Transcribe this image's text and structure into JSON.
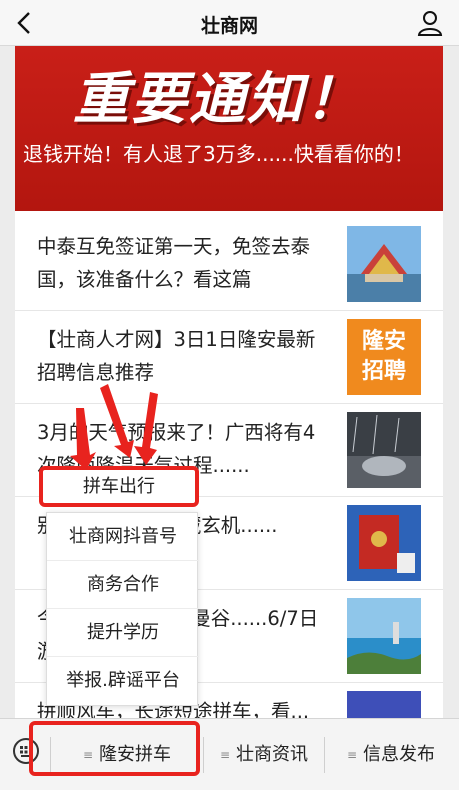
{
  "topbar": {
    "title": "壮商网",
    "back_icon": "back-chevron-icon",
    "user_icon": "user-icon"
  },
  "banner": {
    "headline": "重要通知！",
    "subtext": "退钱开始！有人退了3万多......快看看你的！"
  },
  "news": [
    {
      "text": "中泰互免签证第一天，免签去泰国，该准备什么？看这篇"
    },
    {
      "text": "【壮商人才网】3日1日隆安最新招聘信息推荐",
      "thumb_text": "隆安招聘"
    },
    {
      "text": "3月的天气预报来了！广西将有4次降雨降温天气过程......"
    },
    {
      "text": "别......的扫码“暗藏玄机......"
    },
    {
      "text": "今......推荐：泰国曼谷......6/7日游！"
    },
    {
      "text": "拼顺风车，长途短途拼车，看..."
    }
  ],
  "menu_popup": {
    "items": [
      "拼车出行",
      "壮商网抖音号",
      "商务合作",
      "提升学历",
      "举报.辟谣平台"
    ]
  },
  "bottom_nav": {
    "keyboard_icon": "keyboard-icon",
    "tabs": [
      {
        "label": "隆安拼车"
      },
      {
        "label": "壮商资讯"
      },
      {
        "label": "信息发布"
      }
    ]
  },
  "colors": {
    "banner_red": "#c91f18",
    "highlight_red": "#e8231e"
  }
}
